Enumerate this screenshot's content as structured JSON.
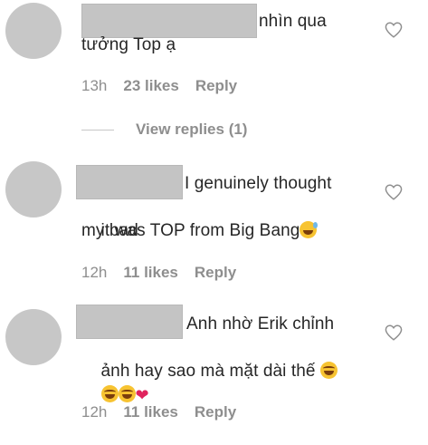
{
  "comments": [
    {
      "line1": "nhìn qua",
      "line2": "tưởng Top ạ",
      "time": "13h",
      "likes": "23 likes",
      "reply": "Reply"
    },
    {
      "line1": "I genuinely thought",
      "line2": "it was TOP from Big Bang",
      "line3": "my bad",
      "time": "12h",
      "likes": "11 likes",
      "reply": "Reply"
    },
    {
      "line1": "Anh nhờ Erik chỉnh",
      "line2": "ảnh hay sao mà mặt dài thế ",
      "time": "12h",
      "likes": "11 likes",
      "reply": "Reply"
    }
  ],
  "view_replies": "View replies (1)",
  "icons": {
    "like": "heart-outline-icon",
    "laugh": "face-with-tears-of-joy-icon",
    "sweat": "grinning-face-with-sweat-icon",
    "heart": "red-heart-icon"
  },
  "colors": {
    "text": "#262626",
    "meta": "#8e8e8e",
    "avatar": "#c7c7c7",
    "heart": "#e0245e"
  }
}
